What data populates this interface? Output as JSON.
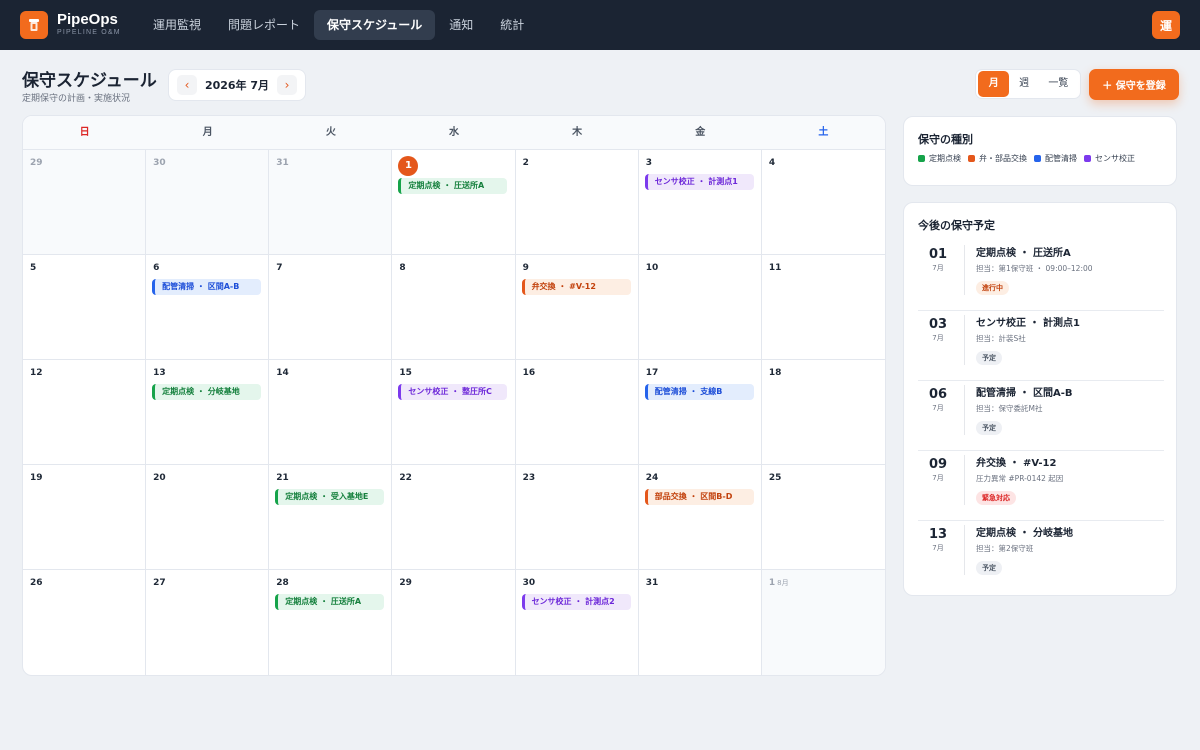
{
  "app": {
    "brand_name": "PipeOps",
    "brand_sub": "PIPELINE O&M",
    "user_initial": "運"
  },
  "nav": {
    "items": [
      {
        "label": "運用監視",
        "active": false
      },
      {
        "label": "問題レポート",
        "active": false
      },
      {
        "label": "保守スケジュール",
        "active": true
      },
      {
        "label": "通知",
        "active": false
      },
      {
        "label": "統計",
        "active": false
      }
    ]
  },
  "header": {
    "title": "保守スケジュール",
    "subtitle": "定期保守の計画・実施状況",
    "month_label": "2026年 7月",
    "prev": "‹",
    "next": "›",
    "views": [
      "月",
      "週",
      "一覧"
    ],
    "register_label": "＋ 保守を登録"
  },
  "calendar": {
    "weekdays": [
      "日",
      "月",
      "火",
      "水",
      "木",
      "金",
      "土"
    ],
    "days": [
      {
        "num": "29",
        "out": true
      },
      {
        "num": "30",
        "out": true
      },
      {
        "num": "31",
        "out": true
      },
      {
        "num": "1",
        "today": true,
        "event": {
          "label": "定期点検 ・ 圧送所A",
          "type": "green"
        }
      },
      {
        "num": "2"
      },
      {
        "num": "3",
        "event": {
          "label": "センサ校正 ・ 計測点1",
          "type": "purple"
        }
      },
      {
        "num": "4"
      },
      {
        "num": "5"
      },
      {
        "num": "6",
        "event": {
          "label": "配管清掃 ・ 区間A-B",
          "type": "blue"
        }
      },
      {
        "num": "7"
      },
      {
        "num": "8"
      },
      {
        "num": "9",
        "event": {
          "label": "弁交換 ・ #V-12",
          "type": "orange"
        }
      },
      {
        "num": "10"
      },
      {
        "num": "11"
      },
      {
        "num": "12"
      },
      {
        "num": "13",
        "event": {
          "label": "定期点検 ・ 分岐基地",
          "type": "green"
        }
      },
      {
        "num": "14"
      },
      {
        "num": "15",
        "event": {
          "label": "センサ校正 ・ 整圧所C",
          "type": "purple"
        }
      },
      {
        "num": "16"
      },
      {
        "num": "17",
        "event": {
          "label": "配管清掃 ・ 支線B",
          "type": "blue"
        }
      },
      {
        "num": "18"
      },
      {
        "num": "19"
      },
      {
        "num": "20"
      },
      {
        "num": "21",
        "event": {
          "label": "定期点検 ・ 受入基地E",
          "type": "green"
        }
      },
      {
        "num": "22"
      },
      {
        "num": "23"
      },
      {
        "num": "24",
        "event": {
          "label": "部品交換 ・ 区間B-D",
          "type": "orange"
        }
      },
      {
        "num": "25"
      },
      {
        "num": "26"
      },
      {
        "num": "27"
      },
      {
        "num": "28",
        "event": {
          "label": "定期点検 ・ 圧送所A",
          "type": "green"
        }
      },
      {
        "num": "29"
      },
      {
        "num": "30",
        "event": {
          "label": "センサ校正 ・ 計測点2",
          "type": "purple"
        }
      },
      {
        "num": "31"
      },
      {
        "num": "1",
        "out": true,
        "month_suffix": "8月"
      }
    ]
  },
  "legend": {
    "title": "保守の種別",
    "items": [
      {
        "label": "定期点検",
        "color": "#16a34a"
      },
      {
        "label": "弁・部品交換",
        "color": "#e4571b"
      },
      {
        "label": "配管清掃",
        "color": "#2563eb"
      },
      {
        "label": "センサ校正",
        "color": "#7c3aed"
      }
    ]
  },
  "upcoming": {
    "title": "今後の保守予定",
    "items": [
      {
        "day": "01",
        "month": "7月",
        "title": "定期点検 ・ 圧送所A",
        "meta": "担当：第1保守班 ・ 09:00–12:00",
        "badge": "進行中",
        "badge_type": "progress"
      },
      {
        "day": "03",
        "month": "7月",
        "title": "センサ校正 ・ 計測点1",
        "meta": "担当：計装S社",
        "badge": "予定",
        "badge_type": "plan"
      },
      {
        "day": "06",
        "month": "7月",
        "title": "配管清掃 ・ 区間A-B",
        "meta": "担当：保守委託M社",
        "badge": "予定",
        "badge_type": "plan"
      },
      {
        "day": "09",
        "month": "7月",
        "title": "弁交換 ・ #V-12",
        "meta": "圧力異常 #PR-0142 起因",
        "badge": "緊急対応",
        "badge_type": "urgent"
      },
      {
        "day": "13",
        "month": "7月",
        "title": "定期点検 ・ 分岐基地",
        "meta": "担当：第2保守班",
        "badge": "予定",
        "badge_type": "plan"
      }
    ]
  },
  "colors": {
    "accent": "#f26b1d",
    "topbar": "#1b2433"
  }
}
